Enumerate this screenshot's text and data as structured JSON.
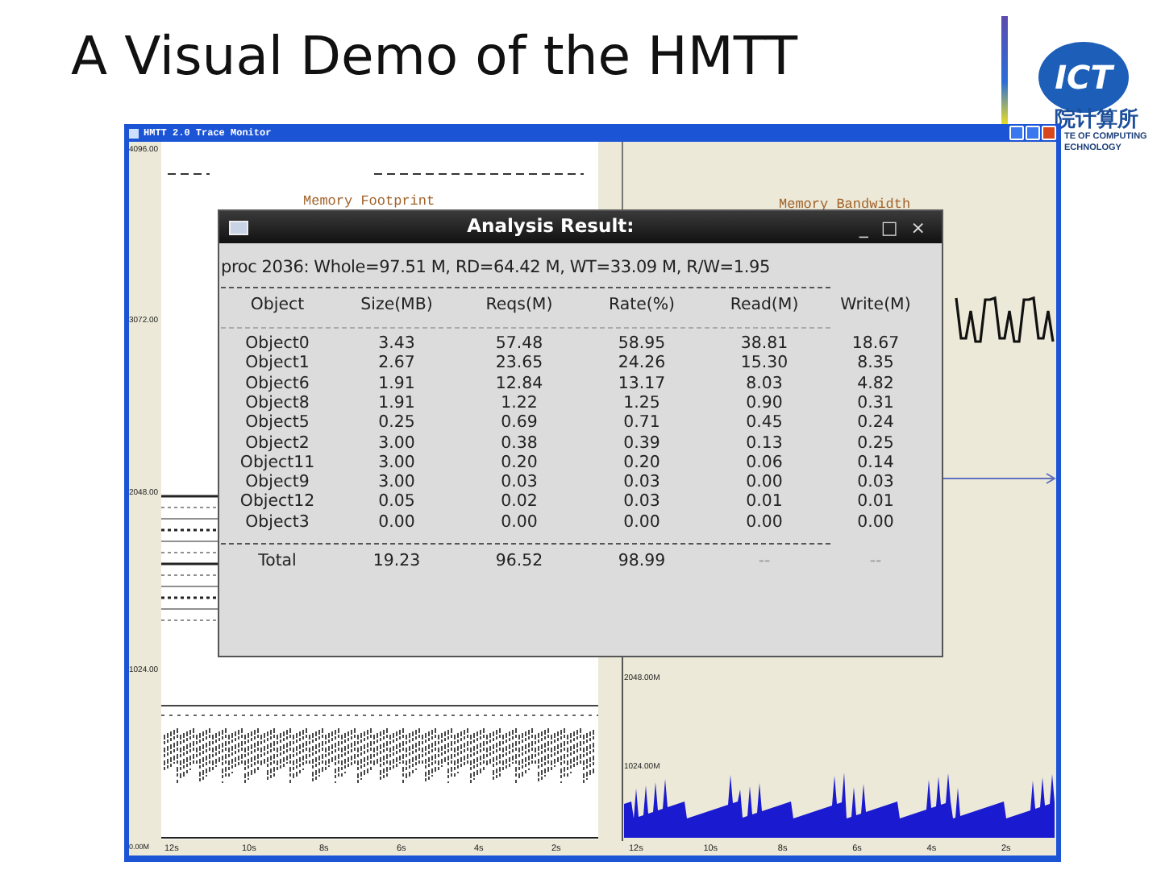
{
  "slide": {
    "title": "A Visual Demo of the HMTT"
  },
  "logo": {
    "mark": "ICT",
    "chinese": "院计算所",
    "english": [
      "TE OF COMPUTING",
      "ECHNOLOGY"
    ]
  },
  "monitor": {
    "title": "HMTT 2.0 Trace Monitor",
    "panels": [
      {
        "kind": "footprint",
        "title": "Memory Footprint",
        "ylabels": [
          "4096.00",
          "3072.00",
          "2048.00"
        ]
      },
      {
        "kind": "bandwidth",
        "title": "Memory Bandwidth"
      },
      {
        "kind": "trace",
        "ylabels": [
          "1024.00",
          "0.00M"
        ],
        "xticks": [
          "12s",
          "10s",
          "8s",
          "6s",
          "4s",
          "2s"
        ]
      },
      {
        "kind": "histogram",
        "ylabels": [
          "2048.00M",
          "1024.00M"
        ],
        "xticks": [
          "12s",
          "10s",
          "8s",
          "6s",
          "4s",
          "2s"
        ]
      }
    ]
  },
  "dialog": {
    "title": "Analysis Result:",
    "controls": [
      "_",
      "□",
      "×"
    ],
    "summary": "proc 2036: Whole=97.51 M, RD=64.42 M, WT=33.09 M, R/W=1.95",
    "columns": [
      "Object",
      "Size(MB)",
      "Reqs(M)",
      "Rate(%)",
      "Read(M)",
      "Write(M)"
    ],
    "rows": [
      [
        "Object0",
        "3.43",
        "57.48",
        "58.95",
        "38.81",
        "18.67"
      ],
      [
        "Object1",
        "2.67",
        "23.65",
        "24.26",
        "15.30",
        "8.35"
      ],
      [
        "Object6",
        "1.91",
        "12.84",
        "13.17",
        "8.03",
        "4.82"
      ],
      [
        "Object8",
        "1.91",
        "1.22",
        "1.25",
        "0.90",
        "0.31"
      ],
      [
        "Object5",
        "0.25",
        "0.69",
        "0.71",
        "0.45",
        "0.24"
      ],
      [
        "Object2",
        "3.00",
        "0.38",
        "0.39",
        "0.13",
        "0.25"
      ],
      [
        "Object11",
        "3.00",
        "0.20",
        "0.20",
        "0.06",
        "0.14"
      ],
      [
        "Object9",
        "3.00",
        "0.03",
        "0.03",
        "0.00",
        "0.03"
      ],
      [
        "Object12",
        "0.05",
        "0.02",
        "0.03",
        "0.01",
        "0.01"
      ],
      [
        "Object3",
        "0.00",
        "0.00",
        "0.00",
        "0.00",
        "0.00"
      ]
    ],
    "total": [
      "Total",
      "19.23",
      "96.52",
      "98.99",
      "--",
      "--"
    ]
  }
}
